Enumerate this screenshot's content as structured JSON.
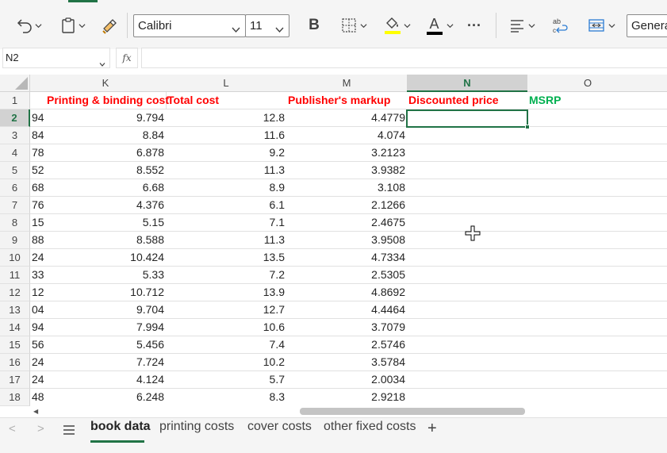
{
  "ribbon": {
    "font_name": "Calibri",
    "font_size": "11",
    "number_format": "General",
    "icons": [
      "undo-icon",
      "paste-icon",
      "format-painter-icon",
      "bold-icon",
      "borders-icon",
      "fill-color-icon",
      "font-color-icon",
      "more-icon",
      "align-icon",
      "wrap-text-icon",
      "merge-icon"
    ],
    "bold_label": "B",
    "font_color_label": "A",
    "more_label": "···",
    "fill_color": "#ffff00",
    "font_color": "#000000",
    "accent": "#217346"
  },
  "formula_bar": {
    "name_box": "N2",
    "fx_label": "fx",
    "formula": ""
  },
  "grid": {
    "columns": [
      {
        "letter": "K",
        "selected": false
      },
      {
        "letter": "L",
        "selected": false
      },
      {
        "letter": "M",
        "selected": false
      },
      {
        "letter": "N",
        "selected": true
      },
      {
        "letter": "O",
        "selected": false
      }
    ],
    "headers": {
      "k": "Printing & binding cost",
      "l": "Total cost",
      "m": "Publisher's markup",
      "n": "Discounted price",
      "o": "MSRP"
    },
    "header_colors": {
      "red": "#ff0000",
      "green": "#00b050"
    },
    "rows": [
      {
        "num": "2",
        "j": "94",
        "k": "9.794",
        "l": "12.8",
        "m": "4.4779"
      },
      {
        "num": "3",
        "j": "84",
        "k": "8.84",
        "l": "11.6",
        "m": "4.074"
      },
      {
        "num": "4",
        "j": "78",
        "k": "6.878",
        "l": "9.2",
        "m": "3.2123"
      },
      {
        "num": "5",
        "j": "52",
        "k": "8.552",
        "l": "11.3",
        "m": "3.9382"
      },
      {
        "num": "6",
        "j": "68",
        "k": "6.68",
        "l": "8.9",
        "m": "3.108"
      },
      {
        "num": "7",
        "j": "76",
        "k": "4.376",
        "l": "6.1",
        "m": "2.1266"
      },
      {
        "num": "8",
        "j": "15",
        "k": "5.15",
        "l": "7.1",
        "m": "2.4675"
      },
      {
        "num": "9",
        "j": "88",
        "k": "8.588",
        "l": "11.3",
        "m": "3.9508"
      },
      {
        "num": "10",
        "j": "24",
        "k": "10.424",
        "l": "13.5",
        "m": "4.7334"
      },
      {
        "num": "11",
        "j": "33",
        "k": "5.33",
        "l": "7.2",
        "m": "2.5305"
      },
      {
        "num": "12",
        "j": "12",
        "k": "10.712",
        "l": "13.9",
        "m": "4.8692"
      },
      {
        "num": "13",
        "j": "04",
        "k": "9.704",
        "l": "12.7",
        "m": "4.4464"
      },
      {
        "num": "14",
        "j": "94",
        "k": "7.994",
        "l": "10.6",
        "m": "3.7079"
      },
      {
        "num": "15",
        "j": "56",
        "k": "5.456",
        "l": "7.4",
        "m": "2.5746"
      },
      {
        "num": "16",
        "j": "24",
        "k": "7.724",
        "l": "10.2",
        "m": "3.5784"
      },
      {
        "num": "17",
        "j": "24",
        "k": "4.124",
        "l": "5.7",
        "m": "2.0034"
      },
      {
        "num": "18",
        "j": "48",
        "k": "6.248",
        "l": "8.3",
        "m": "2.9218"
      }
    ],
    "active_cell": "N2"
  },
  "sheet_tabs": {
    "prev_label": "<",
    "next_label": ">",
    "all_sheets_icon": "hamburger-icon",
    "tabs": [
      {
        "label": "book data",
        "active": true
      },
      {
        "label": "printing costs",
        "active": false
      },
      {
        "label": "cover costs",
        "active": false
      },
      {
        "label": "other fixed costs",
        "active": false
      }
    ],
    "add_label": "+"
  }
}
